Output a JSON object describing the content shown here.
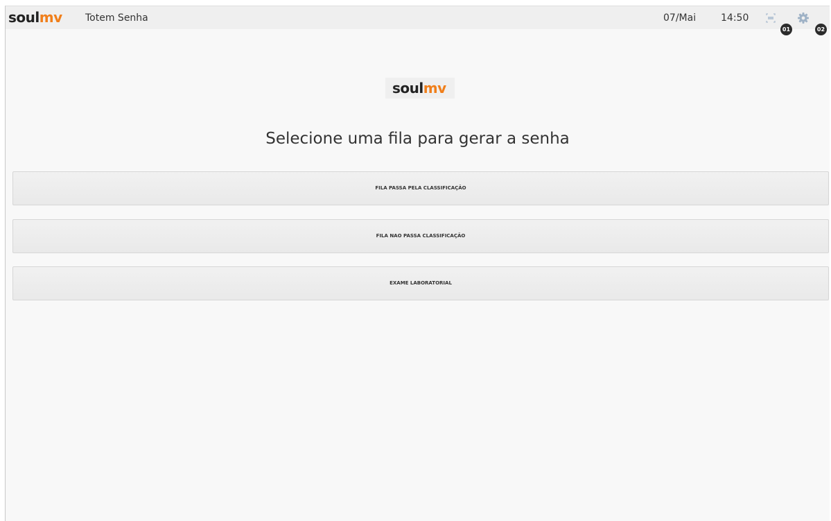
{
  "header": {
    "logo": {
      "soul": "soul",
      "mv": "mv"
    },
    "title": "Totem Senha",
    "date": "07/Mai",
    "time": "14:50",
    "icons": [
      {
        "name": "screen-icon",
        "badge": "01"
      },
      {
        "name": "gear-icon",
        "badge": "02"
      }
    ]
  },
  "main": {
    "logo": {
      "soul": "soul",
      "mv": "mv"
    },
    "heading": "Selecione uma fila para gerar a senha",
    "queues": [
      {
        "label": "FILA PASSA PELA CLASSIFICAÇÃO"
      },
      {
        "label": "FILA NAO PASSA CLASSIFICAÇÃO"
      },
      {
        "label": "EXAME LABORATORIAL"
      }
    ]
  },
  "colors": {
    "brand_orange": "#f07f1b",
    "brand_dark": "#222222",
    "background": "#f8f8f8",
    "topbar": "#efefef"
  }
}
